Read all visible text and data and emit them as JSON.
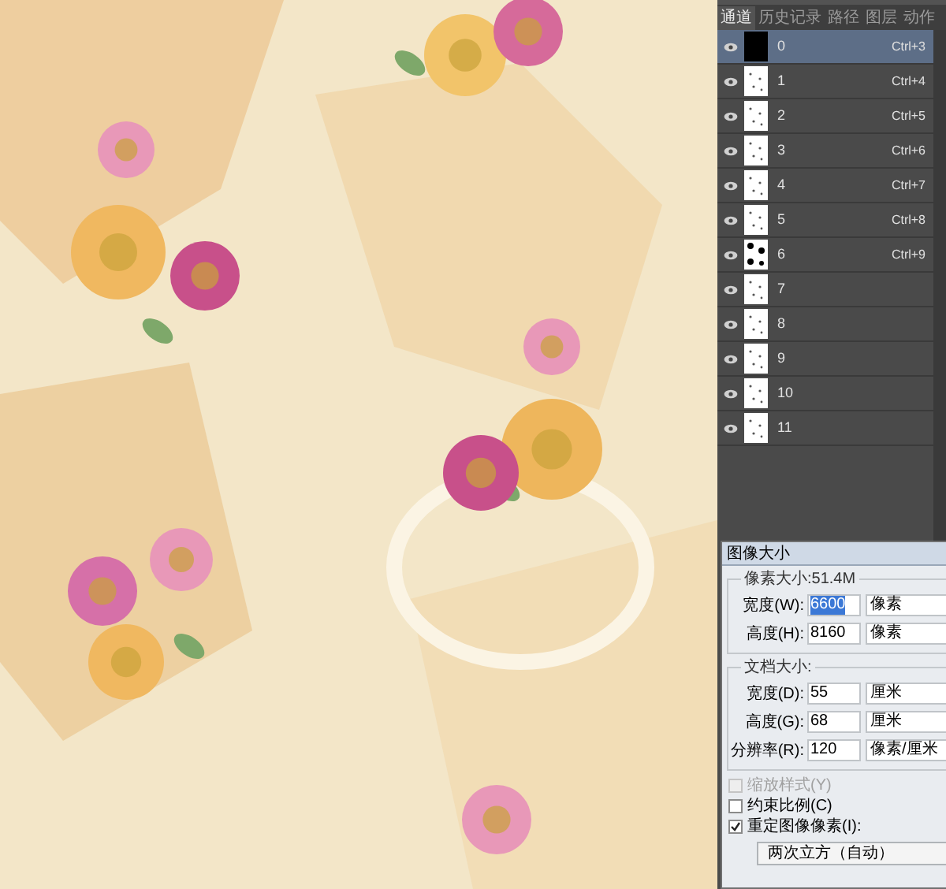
{
  "panel": {
    "tabs": [
      {
        "label": "通道",
        "selected": true
      },
      {
        "label": "历史记录",
        "selected": false
      },
      {
        "label": "路径",
        "selected": false
      },
      {
        "label": "图层",
        "selected": false
      },
      {
        "label": "动作",
        "selected": false
      }
    ],
    "channels": [
      {
        "name": "0",
        "shortcut": "Ctrl+3",
        "visible": true,
        "selected": true,
        "kind": "dark"
      },
      {
        "name": "1",
        "shortcut": "Ctrl+4",
        "visible": true,
        "selected": false,
        "kind": "speckled"
      },
      {
        "name": "2",
        "shortcut": "Ctrl+5",
        "visible": true,
        "selected": false,
        "kind": "speckled"
      },
      {
        "name": "3",
        "shortcut": "Ctrl+6",
        "visible": true,
        "selected": false,
        "kind": "speckled"
      },
      {
        "name": "4",
        "shortcut": "Ctrl+7",
        "visible": true,
        "selected": false,
        "kind": "speckled"
      },
      {
        "name": "5",
        "shortcut": "Ctrl+8",
        "visible": true,
        "selected": false,
        "kind": "speckled"
      },
      {
        "name": "6",
        "shortcut": "Ctrl+9",
        "visible": true,
        "selected": false,
        "kind": "spotted"
      },
      {
        "name": "7",
        "visible": true,
        "selected": false,
        "kind": "speckled"
      },
      {
        "name": "8",
        "visible": true,
        "selected": false,
        "kind": "speckled"
      },
      {
        "name": "9",
        "visible": true,
        "selected": false,
        "kind": "speckled"
      },
      {
        "name": "10",
        "visible": true,
        "selected": false,
        "kind": "speckled"
      },
      {
        "name": "11",
        "visible": true,
        "selected": false,
        "kind": "speckled"
      }
    ]
  },
  "dialog": {
    "title": "图像大小",
    "pixel_group": {
      "title": "像素大小:51.4M",
      "rows": [
        {
          "label": "宽度(W):",
          "value": "6600",
          "unit": "像素",
          "value_selected": true
        },
        {
          "label": "高度(H):",
          "value": "8160",
          "unit": "像素",
          "value_selected": false
        }
      ]
    },
    "document_group": {
      "title": "文档大小:",
      "rows": [
        {
          "label": "宽度(D):",
          "value": "55",
          "unit": "厘米",
          "value_selected": false
        },
        {
          "label": "高度(G):",
          "value": "68",
          "unit": "厘米",
          "value_selected": false
        },
        {
          "label": "分辨率(R):",
          "value": "120",
          "unit": "像素/厘米",
          "value_selected": false
        }
      ]
    },
    "checkboxes": [
      {
        "label": "缩放样式(Y)",
        "checked": false,
        "disabled": true
      },
      {
        "label": "约束比例(C)",
        "checked": false,
        "disabled": false
      },
      {
        "label": "重定图像像素(I):",
        "checked": true,
        "disabled": false
      }
    ],
    "resample": "两次立方（自动）"
  }
}
